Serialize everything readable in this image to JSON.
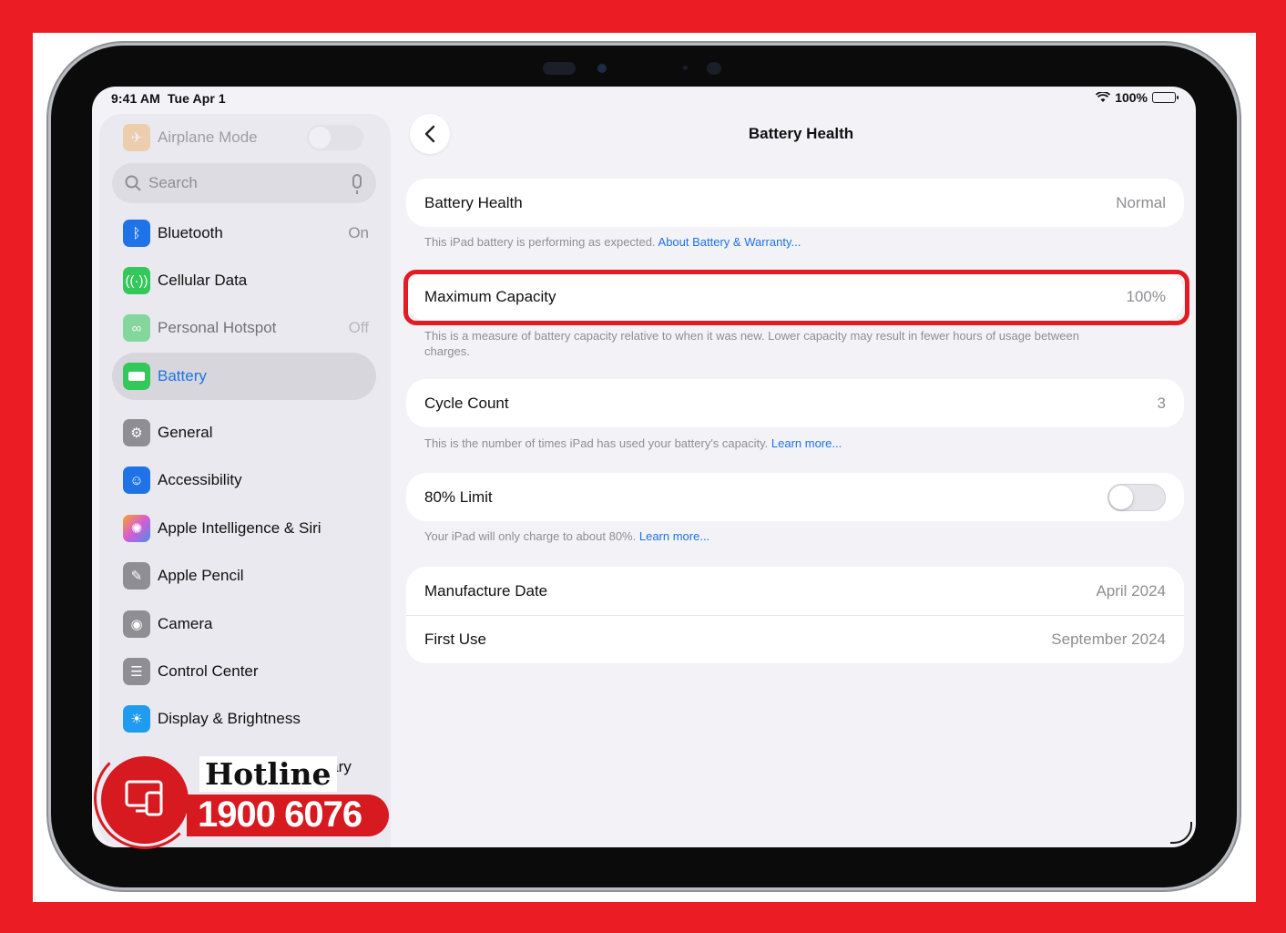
{
  "status_bar": {
    "time": "9:41 AM",
    "date": "Tue Apr 1",
    "battery_percent": "100%"
  },
  "sidebar": {
    "airplane_mode": {
      "label": "Airplane Mode",
      "icon": "airplane-icon",
      "color": "#f29b38"
    },
    "search_placeholder": "Search",
    "items": [
      {
        "label": "Bluetooth",
        "value": "On",
        "icon": "bluetooth-icon",
        "color": "#1f73e6"
      },
      {
        "label": "Cellular Data",
        "value": "",
        "icon": "antenna-icon",
        "color": "#34c759"
      },
      {
        "label": "Personal Hotspot",
        "value": "Off",
        "icon": "hotspot-icon",
        "color": "#34c759"
      },
      {
        "label": "Battery",
        "value": "",
        "icon": "battery-icon",
        "color": "#34c759"
      },
      {
        "label": "General",
        "value": "",
        "icon": "gear-icon",
        "color": "#8e8e93"
      },
      {
        "label": "Accessibility",
        "value": "",
        "icon": "accessibility-icon",
        "color": "#1f73e6"
      },
      {
        "label": "Apple Intelligence & Siri",
        "value": "",
        "icon": "siri-icon",
        "color": "#d65bd8"
      },
      {
        "label": "Apple Pencil",
        "value": "",
        "icon": "pencil-icon",
        "color": "#8e8e93"
      },
      {
        "label": "Camera",
        "value": "",
        "icon": "camera-icon",
        "color": "#8e8e93"
      },
      {
        "label": "Control Center",
        "value": "",
        "icon": "toggles-icon",
        "color": "#8e8e93"
      },
      {
        "label": "Display & Brightness",
        "value": "",
        "icon": "sun-icon",
        "color": "#1f9bf0"
      }
    ],
    "partial_item_label": "brary",
    "selected_index": 3
  },
  "hotline": {
    "title": "Hotline",
    "phone": "1900 6076",
    "color": "#d71920"
  },
  "detail": {
    "nav_title": "Battery Health",
    "battery_health": {
      "label": "Battery Health",
      "value": "Normal"
    },
    "battery_health_note": "This iPad battery is performing as expected.",
    "battery_health_link": "About Battery & Warranty...",
    "maximum_capacity": {
      "label": "Maximum Capacity",
      "value": "100%"
    },
    "maximum_capacity_note": "This is a measure of battery capacity relative to when it was new. Lower capacity may result in fewer hours of usage between charges.",
    "cycle_count": {
      "label": "Cycle Count",
      "value": "3"
    },
    "cycle_count_note": "This is the number of times iPad has used your battery's capacity.",
    "cycle_count_link": "Learn more...",
    "limit_80": {
      "label": "80% Limit",
      "enabled": false
    },
    "limit_80_note": "Your iPad will only charge to about 80%.",
    "limit_80_link": "Learn more...",
    "manufacture_date": {
      "label": "Manufacture Date",
      "value": "April 2024"
    },
    "first_use": {
      "label": "First Use",
      "value": "September 2024"
    }
  },
  "colors": {
    "accent": "#1f73e6",
    "highlight": "#e31b23",
    "frame": "#ec1c24"
  }
}
